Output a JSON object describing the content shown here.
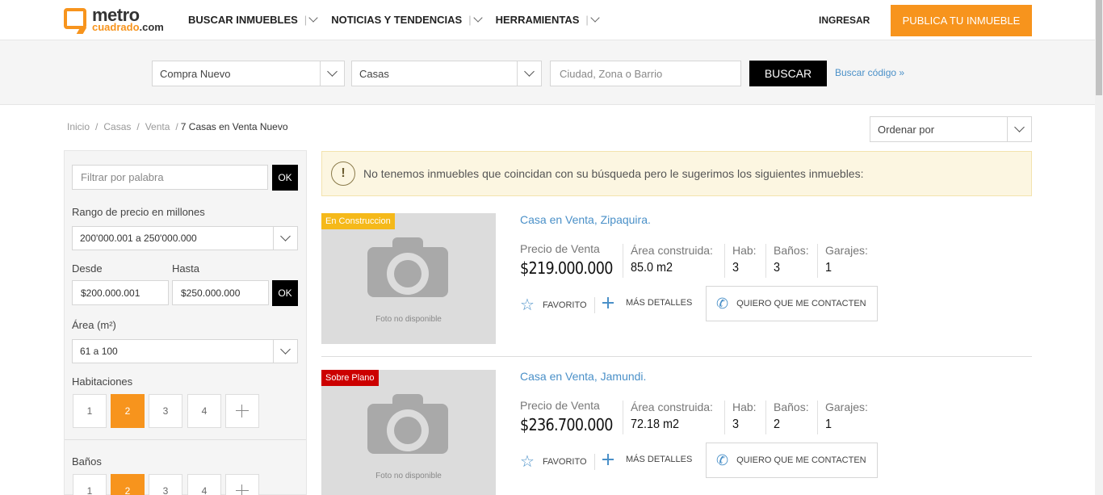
{
  "header": {
    "logo_main": "metro",
    "logo_sub": "cuadrado",
    "logo_tld": ".com",
    "nav": [
      "BUSCAR INMUEBLES",
      "NOTICIAS Y TENDENCIAS",
      "HERRAMIENTAS"
    ],
    "login": "INGRESAR",
    "publish": "PUBLICA TU INMUEBLE"
  },
  "search": {
    "operation": "Compra Nuevo",
    "type": "Casas",
    "location_placeholder": "Ciudad, Zona o Barrio",
    "button": "BUSCAR",
    "code_link": "Buscar código »"
  },
  "breadcrumb": {
    "items": [
      "Inicio",
      "Casas",
      "Venta"
    ],
    "current": "7  Casas en Venta Nuevo"
  },
  "sort": {
    "label": "Ordenar por"
  },
  "sidebar": {
    "keyword_placeholder": "Filtrar por palabra",
    "ok": "OK",
    "price_title": "Rango de precio en millones",
    "price_range": "200'000.001 a 250'000.000",
    "from_label": "Desde",
    "to_label": "Hasta",
    "from_value": "$200.000.001",
    "to_value": "$250.000.000",
    "area_title": "Área (m²)",
    "area_range": "61 a 100",
    "rooms_title": "Habitaciones",
    "rooms": [
      "1",
      "2",
      "3",
      "4"
    ],
    "rooms_selected": "2",
    "baths_title": "Baños",
    "baths": [
      "1",
      "2",
      "3",
      "4"
    ],
    "baths_selected": "2"
  },
  "alert": {
    "icon": "!",
    "text": "No tenemos inmuebles que coincidan con su búsqueda pero le sugerimos los siguientes inmuebles:"
  },
  "listings": [
    {
      "badge": "En Construccion",
      "badge_color": "#f5b91a",
      "photo_caption": "Foto no disponible",
      "title": "Casa en Venta, Zipaquira.",
      "price_label": "Precio de Venta",
      "price": "$219.000.000",
      "area_label": "Área construida:",
      "area": "85.0 m2",
      "rooms_label": "Hab:",
      "rooms": "3",
      "baths_label": "Baños:",
      "baths": "3",
      "garages_label": "Garajes:",
      "garages": "1",
      "fav": "FAVORITO",
      "details": "MÁS DETALLES",
      "contact": "QUIERO QUE ME CONTACTEN"
    },
    {
      "badge": "Sobre Plano",
      "badge_color": "#cc0000",
      "photo_caption": "Foto no disponible",
      "title": "Casa en Venta, Jamundi.",
      "price_label": "Precio de Venta",
      "price": "$236.700.000",
      "area_label": "Área construida:",
      "area": "72.18 m2",
      "rooms_label": "Hab:",
      "rooms": "3",
      "baths_label": "Baños:",
      "baths": "2",
      "garages_label": "Garajes:",
      "garages": "1",
      "fav": "FAVORITO",
      "details": "MÁS DETALLES",
      "contact": "QUIERO QUE ME CONTACTEN"
    }
  ],
  "colors": {
    "brand": "#f7941d",
    "link": "#4a90c8",
    "alert_bg": "#fcf6e1"
  }
}
